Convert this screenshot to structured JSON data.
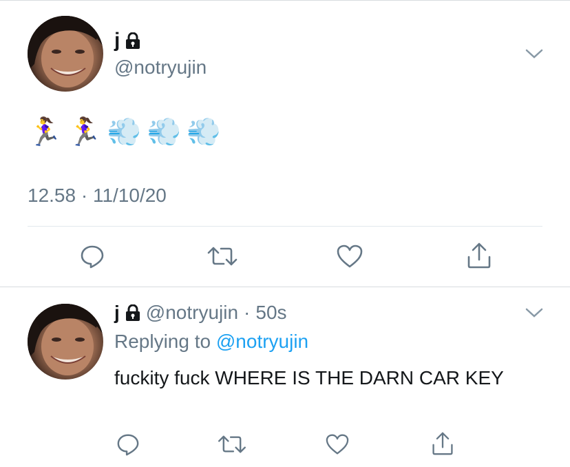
{
  "tweet": {
    "display_name": "j",
    "handle": "@notryujin",
    "emojis": [
      "🏃‍♀️",
      "🏃‍♀️",
      "💨",
      "💨",
      "💨"
    ],
    "timestamp": "12.58 · 11/10/20",
    "actions": [
      "reply",
      "retweet",
      "like",
      "share"
    ]
  },
  "reply": {
    "display_name": "j",
    "handle": "@notryujin",
    "separator": "·",
    "time": "50s",
    "replying_prefix": "Replying to",
    "replying_handle": "@notryujin",
    "text": "fuckity fuck WHERE IS THE DARN CAR KEY"
  },
  "colors": {
    "text": "#14171a",
    "muted": "#657786",
    "link": "#1da1f2",
    "divider": "#e1e8ed"
  }
}
